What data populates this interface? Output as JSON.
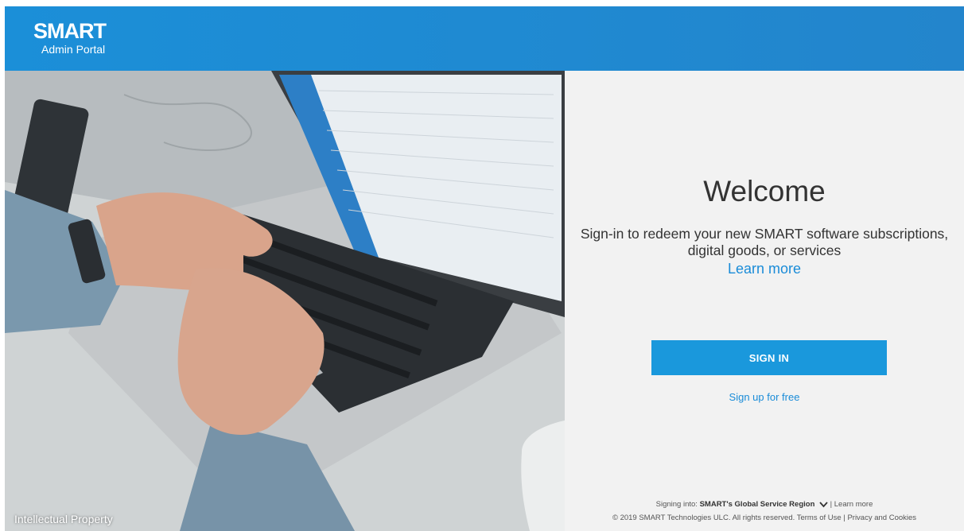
{
  "header": {
    "logo_text": "SMART",
    "portal_name": "Admin Portal",
    "background_color": "#1f8ad2"
  },
  "hero": {
    "caption": "Intellectual Property",
    "image_subject": "hands typing on laptop keyboard"
  },
  "panel": {
    "title": "Welcome",
    "description_line1": "Sign-in to redeem your new SMART software subscriptions,",
    "description_line2": "digital goods, or services",
    "learn_more": "Learn more",
    "signin_button": "SIGN IN",
    "signup_link": "Sign up for free",
    "accent_color": "#1a98dc"
  },
  "footer": {
    "signing_into_label": "Signing into:",
    "region": "SMART's Global Service Region",
    "separator": "|",
    "learn_more": "Learn more",
    "copyright": "© 2019 SMART Technologies ULC. All rights reserved.",
    "terms": "Terms of Use",
    "privacy": "Privacy and Cookies"
  }
}
